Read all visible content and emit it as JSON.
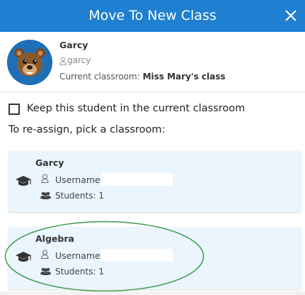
{
  "header": {
    "title": "Move To New Class",
    "close_icon": "close-icon"
  },
  "student": {
    "name": "Garcy",
    "username": "garcy",
    "current_classroom_label": "Current classroom:",
    "current_classroom": "Miss Mary's class",
    "avatar_icon": "bear-avatar-icon"
  },
  "keep": {
    "label": "Keep this student in the current classroom",
    "checked": false
  },
  "reassign_label": "To re-assign, pick a classroom:",
  "classes": [
    {
      "title": "Garcy",
      "username_label": "Username:",
      "username_value": "",
      "students_label": "Students: 1"
    },
    {
      "title": "Algebra",
      "username_label": "Username:",
      "username_value": "",
      "students_label": "Students: 1"
    }
  ],
  "colors": {
    "header_bg": "#1f7fd1",
    "card_bg": "#eaf5fd",
    "annotation": "#3a9a4a"
  }
}
